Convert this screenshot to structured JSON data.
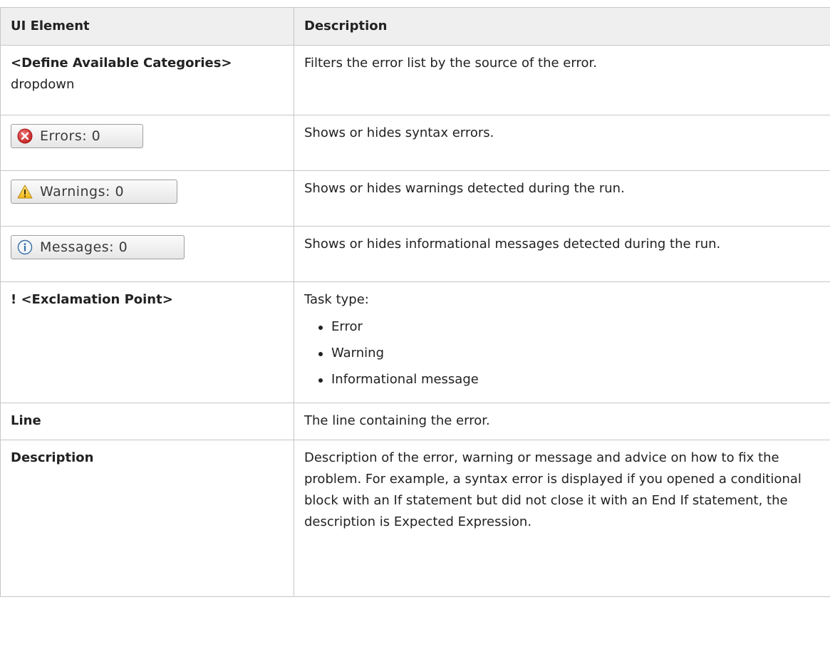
{
  "table": {
    "header": {
      "col_element": "UI Element",
      "col_description": "Description"
    },
    "rows": {
      "categories": {
        "element_bold": "<Define Available Categories>",
        "element_suffix": "dropdown",
        "description": "Filters the error list by the source of the error."
      },
      "errors": {
        "button_label": "Errors: 0",
        "icon": "error-circle-icon",
        "description": "Shows or hides syntax errors."
      },
      "warnings": {
        "button_label": "Warnings: 0",
        "icon": "warning-triangle-icon",
        "description": "Shows or hides warnings detected during the run."
      },
      "messages": {
        "button_label": "Messages: 0",
        "icon": "info-circle-icon",
        "description": "Shows or hides informational messages detected during the run."
      },
      "exclamation": {
        "element": "! <Exclamation Point>",
        "intro": "Task type:",
        "types": [
          "Error",
          "Warning",
          "Informational message"
        ]
      },
      "line": {
        "element": "Line",
        "description": "The line containing the error."
      },
      "description": {
        "element": "Description",
        "description": "Description of the error, warning or message and advice on how to fix the problem. For example, a syntax error is displayed if you opened a conditional block with an If statement but did not close it with an End If statement, the description is Expected Expression."
      }
    }
  },
  "colors": {
    "header_bg": "#efefef",
    "border": "#c6c6c6",
    "error_red": "#d83a3a",
    "warning_yellow": "#f2c230",
    "info_blue": "#3a6ea8"
  }
}
